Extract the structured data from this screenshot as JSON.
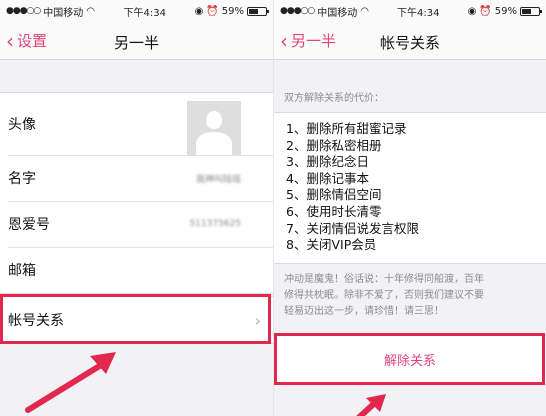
{
  "status": {
    "carrier": "中国移动",
    "time": "下午4:34",
    "battery": "59%",
    "battery_fraction": 0.59
  },
  "left": {
    "back_label": "设置",
    "title": "另一半",
    "rows": {
      "avatar": "头像",
      "name": "名字",
      "name_value": "我神叫陆瑶",
      "love_id": "恩爱号",
      "love_id_value": "511375625",
      "email": "邮箱",
      "account_relation": "帐号关系"
    }
  },
  "right": {
    "back_label": "另一半",
    "title": "帐号关系",
    "section_header": "双方解除关系的代价：",
    "costs": [
      "1、删除所有甜蜜记录",
      "2、删除私密相册",
      "3、删除纪念日",
      "4、删除记事本",
      "5、删除情侣空间",
      "6、使用时长清零",
      "7、关闭情侣说发言权限",
      "8、关闭VIP会员"
    ],
    "note_lines": [
      "冲动是魔鬼！俗话说：十年修得同船渡，百年",
      "修得共枕眠。除非不爱了，否则我们建议不要",
      "轻易迈出这一步，请珍惜！请三思！"
    ],
    "dissolve_button": "解除关系"
  },
  "colors": {
    "accent": "#e0457b",
    "highlight": "#e3284f"
  }
}
